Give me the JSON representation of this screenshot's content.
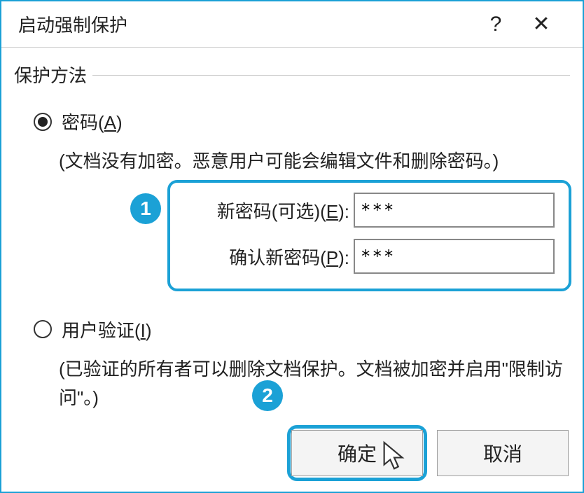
{
  "titlebar": {
    "title": "启动强制保护",
    "help": "?",
    "close": "✕"
  },
  "group": {
    "label": "保护方法"
  },
  "options": {
    "password": {
      "label_prefix": "密码(",
      "accel": "A",
      "label_suffix": ")",
      "desc": "(文档没有加密。恶意用户可能会编辑文件和删除密码。)",
      "checked": true
    },
    "user_auth": {
      "label_prefix": "用户验证(",
      "accel": "I",
      "label_suffix": ")",
      "desc": "(已验证的所有者可以删除文档保护。文档被加密并启用\"限制访问\"。)",
      "checked": false
    }
  },
  "password_fields": {
    "new_label_prefix": "新密码(可选)(",
    "new_accel": "E",
    "new_label_suffix": "):",
    "new_value": "***",
    "confirm_label_prefix": "确认新密码(",
    "confirm_accel": "P",
    "confirm_label_suffix": "):",
    "confirm_value": "***"
  },
  "callouts": {
    "one": "1",
    "two": "2"
  },
  "buttons": {
    "ok": "确定",
    "cancel": "取消"
  }
}
